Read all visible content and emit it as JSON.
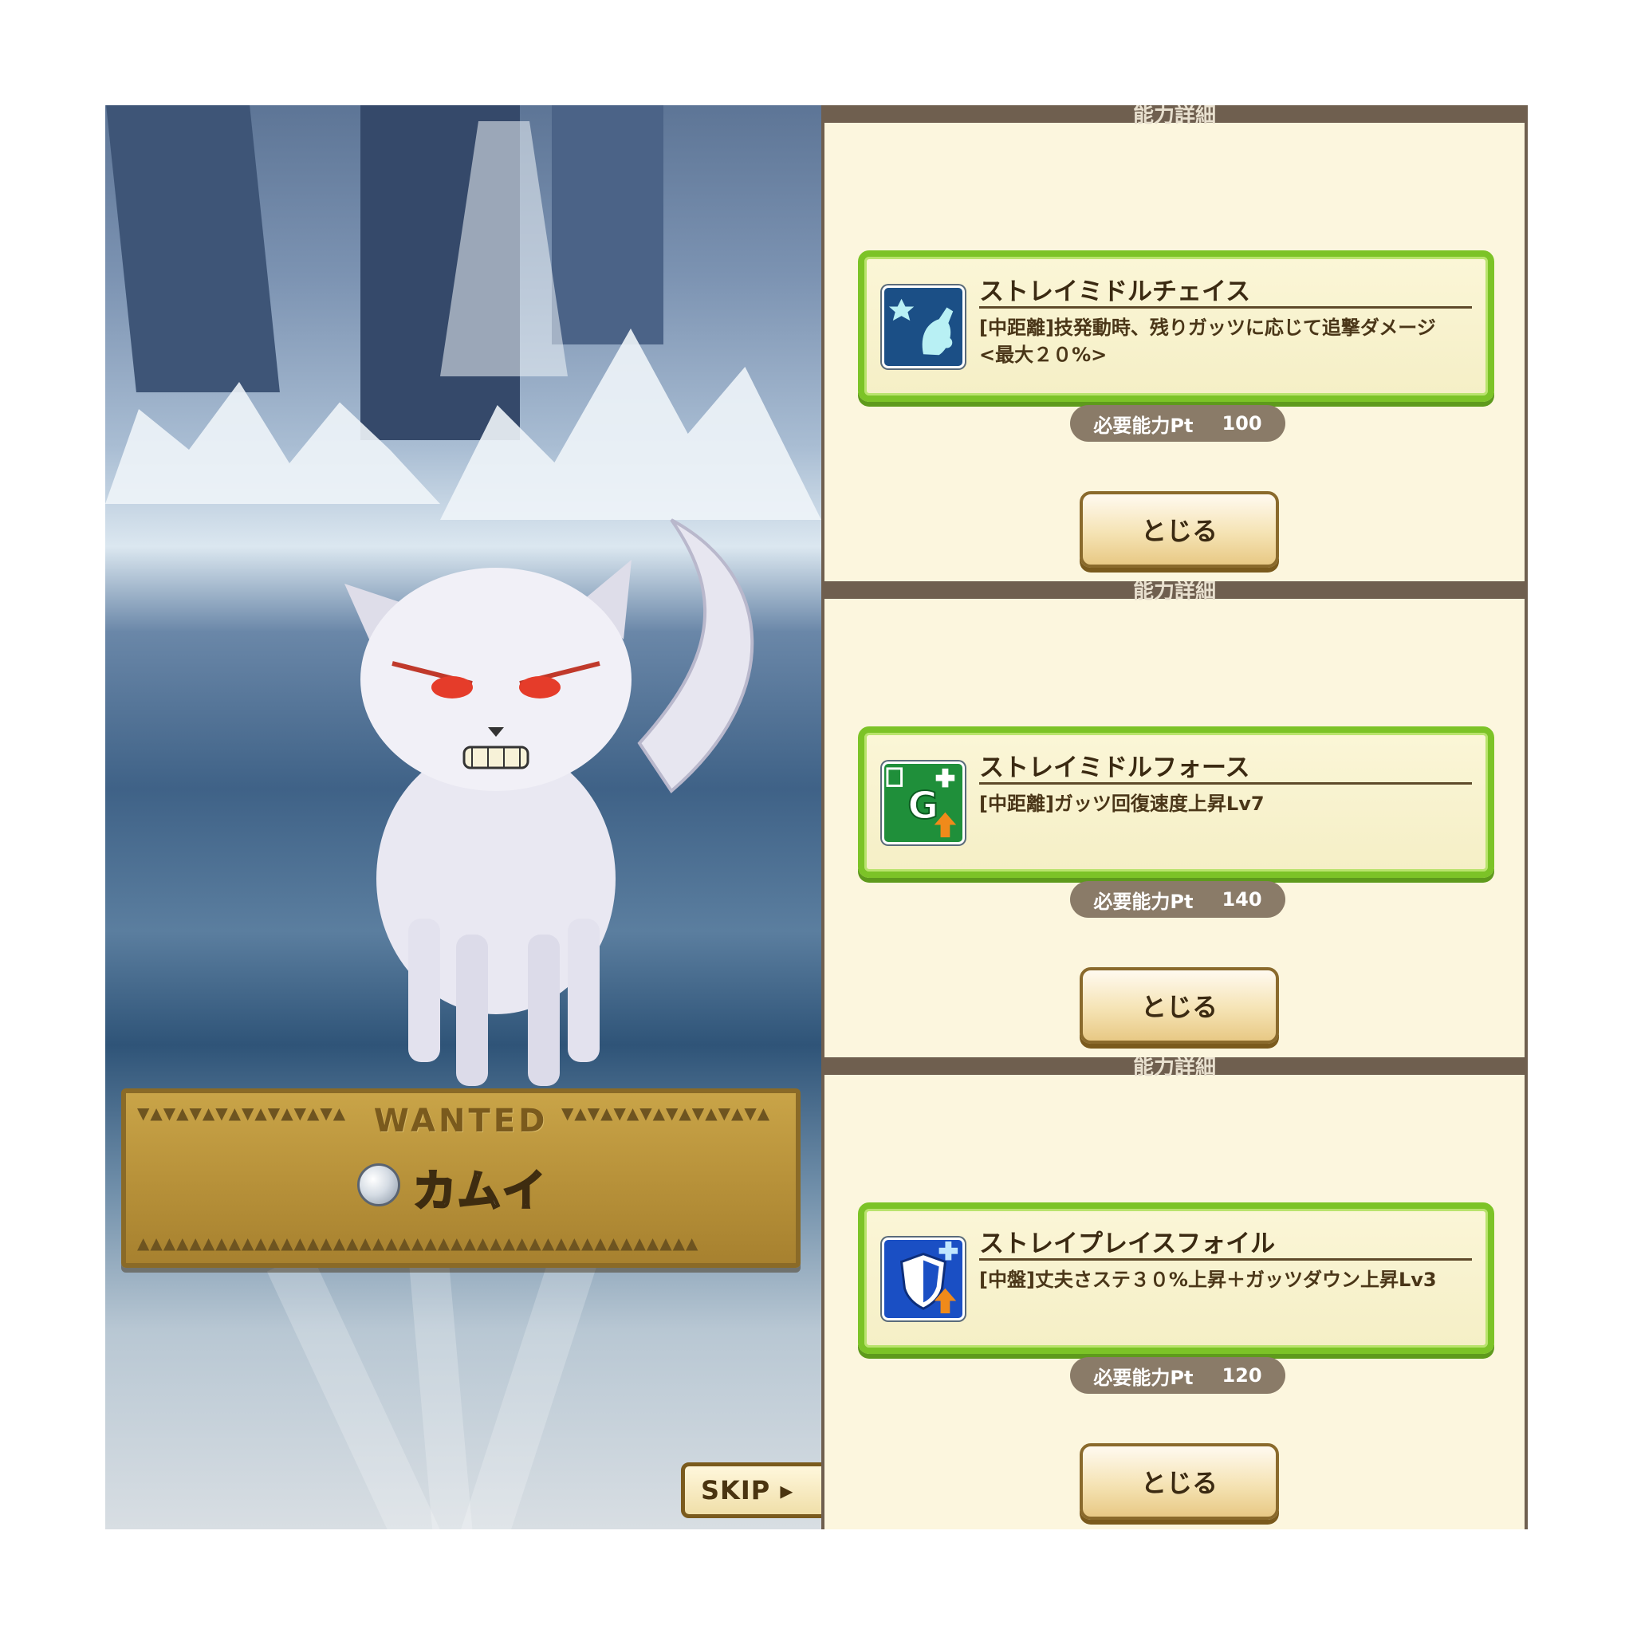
{
  "scene": {
    "banner": {
      "title": "WANTED",
      "name": "カムイ",
      "triangles_left": "▼▲▼▲▼▲▼▲▼▲▼▲▼▲▼▲",
      "triangles_right": "▼▲▼▲▼▲▼▲▼▲▼▲▼▲▼▲",
      "triangles_bottom": "▲▲▲▲▲▲▲▲▲▲▲▲▲▲▲▲▲▲▲▲▲▲▲▲▲▲▲▲▲▲▲▲▲▲▲▲▲▲▲▲▲▲▲"
    },
    "skip_label": "SKIP ▸"
  },
  "panels": [
    {
      "header": "能力詳細",
      "icon": "dog-chase-icon",
      "icon_color": "#1b4f86",
      "title": "ストレイミドルチェイス",
      "description": "[中距離]技発動時、残りガッツに応じて追撃ダメージ\n<最大２０%>",
      "pt_label": "必要能力Pt",
      "pt_value": "100",
      "close_label": "とじる"
    },
    {
      "header": "能力詳細",
      "icon": "guts-recovery-icon",
      "icon_color": "#1f8f3a",
      "title": "ストレイミドルフォース",
      "description": "[中距離]ガッツ回復速度上昇Lv7",
      "pt_label": "必要能力Pt",
      "pt_value": "140",
      "close_label": "とじる"
    },
    {
      "header": "能力詳細",
      "icon": "shield-up-icon",
      "icon_color": "#1a4fc4",
      "title": "ストレイプレイスフォイル",
      "description": "[中盤]丈夫さステ３０%上昇＋ガッツダウン上昇Lv3",
      "pt_label": "必要能力Pt",
      "pt_value": "120",
      "close_label": "とじる"
    }
  ]
}
